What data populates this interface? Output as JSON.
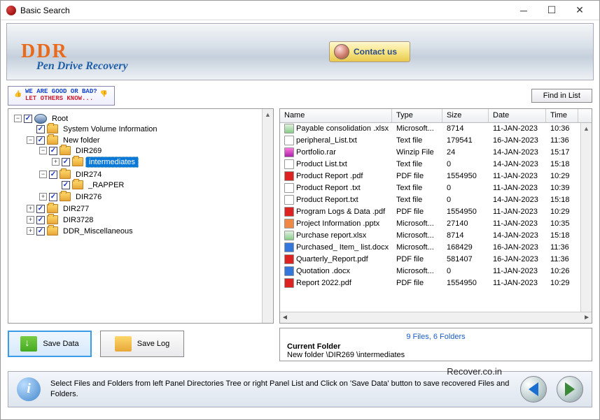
{
  "window": {
    "title": "Basic Search"
  },
  "banner": {
    "logo": "DDR",
    "subtitle": "Pen Drive Recovery",
    "contact": "Contact us"
  },
  "toolbar": {
    "feedback_l1": "WE ARE GOOD OR BAD?",
    "feedback_l2": "LET OTHERS KNOW...",
    "find": "Find in List"
  },
  "tree": {
    "root": "Root",
    "sys_vol": "System Volume Information",
    "new_folder": "New folder",
    "dir269": "DIR269",
    "intermediates": "intermediates",
    "dir274": "DIR274",
    "rapper": "_RAPPER",
    "dir276": "DIR276",
    "dir277": "DIR277",
    "dir3728": "DIR3728",
    "ddr_misc": "DDR_Miscellaneous"
  },
  "list": {
    "headers": {
      "name": "Name",
      "type": "Type",
      "size": "Size",
      "date": "Date",
      "time": "Time"
    },
    "rows": [
      {
        "icon": "xls",
        "name": "Payable consolidation .xlsx",
        "type": "Microsoft...",
        "size": "8714",
        "date": "11-JAN-2023",
        "time": "10:36"
      },
      {
        "icon": "txt",
        "name": "peripheral_List.txt",
        "type": "Text file",
        "size": "179541",
        "date": "16-JAN-2023",
        "time": "11:36"
      },
      {
        "icon": "rar",
        "name": "Portfolio.rar",
        "type": "Winzip File",
        "size": "24",
        "date": "14-JAN-2023",
        "time": "15:17"
      },
      {
        "icon": "txt",
        "name": "Product List.txt",
        "type": "Text file",
        "size": "0",
        "date": "14-JAN-2023",
        "time": "15:18"
      },
      {
        "icon": "pdf",
        "name": "Product Report .pdf",
        "type": "PDF file",
        "size": "1554950",
        "date": "11-JAN-2023",
        "time": "10:29"
      },
      {
        "icon": "txt",
        "name": "Product Report .txt",
        "type": "Text file",
        "size": "0",
        "date": "11-JAN-2023",
        "time": "10:39"
      },
      {
        "icon": "txt",
        "name": "Product Report.txt",
        "type": "Text file",
        "size": "0",
        "date": "14-JAN-2023",
        "time": "15:18"
      },
      {
        "icon": "pdf",
        "name": "Program Logs & Data .pdf",
        "type": "PDF file",
        "size": "1554950",
        "date": "11-JAN-2023",
        "time": "10:29"
      },
      {
        "icon": "ppt",
        "name": "Project Information .pptx",
        "type": "Microsoft...",
        "size": "27140",
        "date": "11-JAN-2023",
        "time": "10:35"
      },
      {
        "icon": "xls",
        "name": "Purchase report.xlsx",
        "type": "Microsoft...",
        "size": "8714",
        "date": "14-JAN-2023",
        "time": "15:18"
      },
      {
        "icon": "doc",
        "name": "Purchased_ Item_ list.docx",
        "type": "Microsoft...",
        "size": "168429",
        "date": "16-JAN-2023",
        "time": "11:36"
      },
      {
        "icon": "pdf",
        "name": "Quarterly_Report.pdf",
        "type": "PDF file",
        "size": "581407",
        "date": "16-JAN-2023",
        "time": "11:36"
      },
      {
        "icon": "doc",
        "name": "Quotation .docx",
        "type": "Microsoft...",
        "size": "0",
        "date": "11-JAN-2023",
        "time": "10:26"
      },
      {
        "icon": "pdf",
        "name": "Report 2022.pdf",
        "type": "PDF file",
        "size": "1554950",
        "date": "11-JAN-2023",
        "time": "10:29"
      }
    ]
  },
  "buttons": {
    "save_data": "Save Data",
    "save_log": "Save Log"
  },
  "info": {
    "count": "9 Files, 6 Folders",
    "title": "Current Folder",
    "path": "New folder \\DIR269 \\intermediates"
  },
  "footer": {
    "text": "Select Files and Folders from left Panel Directories Tree or right Panel List and Click on 'Save Data' button to save recovered Files and Folders."
  },
  "watermark": "Recover.co.in"
}
